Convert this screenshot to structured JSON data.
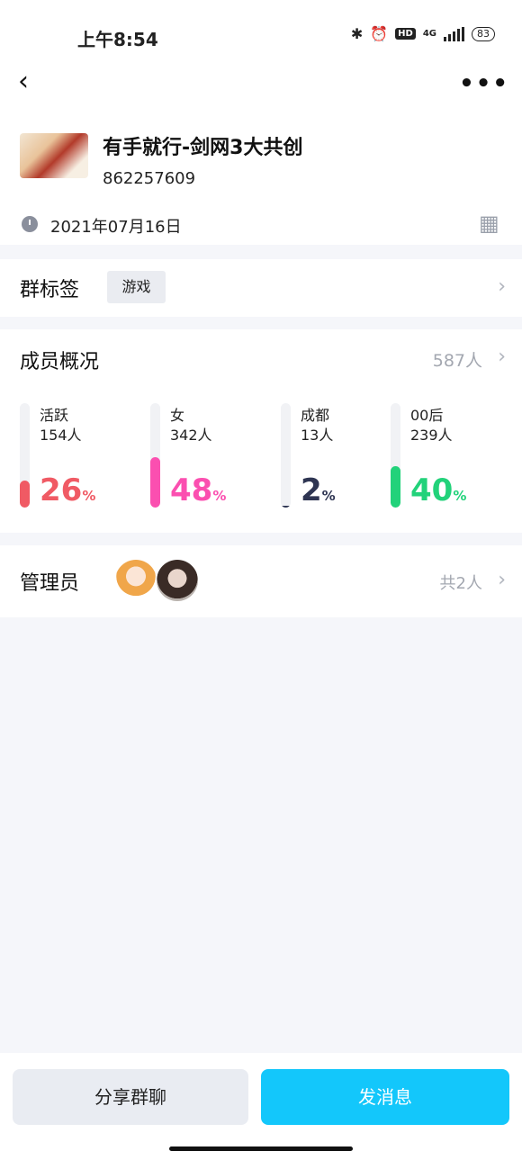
{
  "status_bar": {
    "time": "上午8:54",
    "network": "4G",
    "hd": "HD",
    "battery": "83"
  },
  "group": {
    "name": "有手就行-剑网3大共创",
    "id": "862257609",
    "created": "2021年07月16日"
  },
  "tags": {
    "title": "群标签",
    "items": [
      "游戏"
    ]
  },
  "members": {
    "title": "成员概况",
    "total": "587人",
    "stats": [
      {
        "label": "活跃",
        "count": "154人",
        "percent": 26,
        "color": "#f05a64"
      },
      {
        "label": "女",
        "count": "342人",
        "percent": 48,
        "color": "#fb4fb0"
      },
      {
        "label": "成都",
        "count": "13人",
        "percent": 2,
        "color": "#2e3552"
      },
      {
        "label": "00后",
        "count": "239人",
        "percent": 40,
        "color": "#22d27a"
      }
    ],
    "percent_unit": "%"
  },
  "admins": {
    "title": "管理员",
    "total": "共2人"
  },
  "buttons": {
    "share": "分享群聊",
    "send": "发消息"
  }
}
